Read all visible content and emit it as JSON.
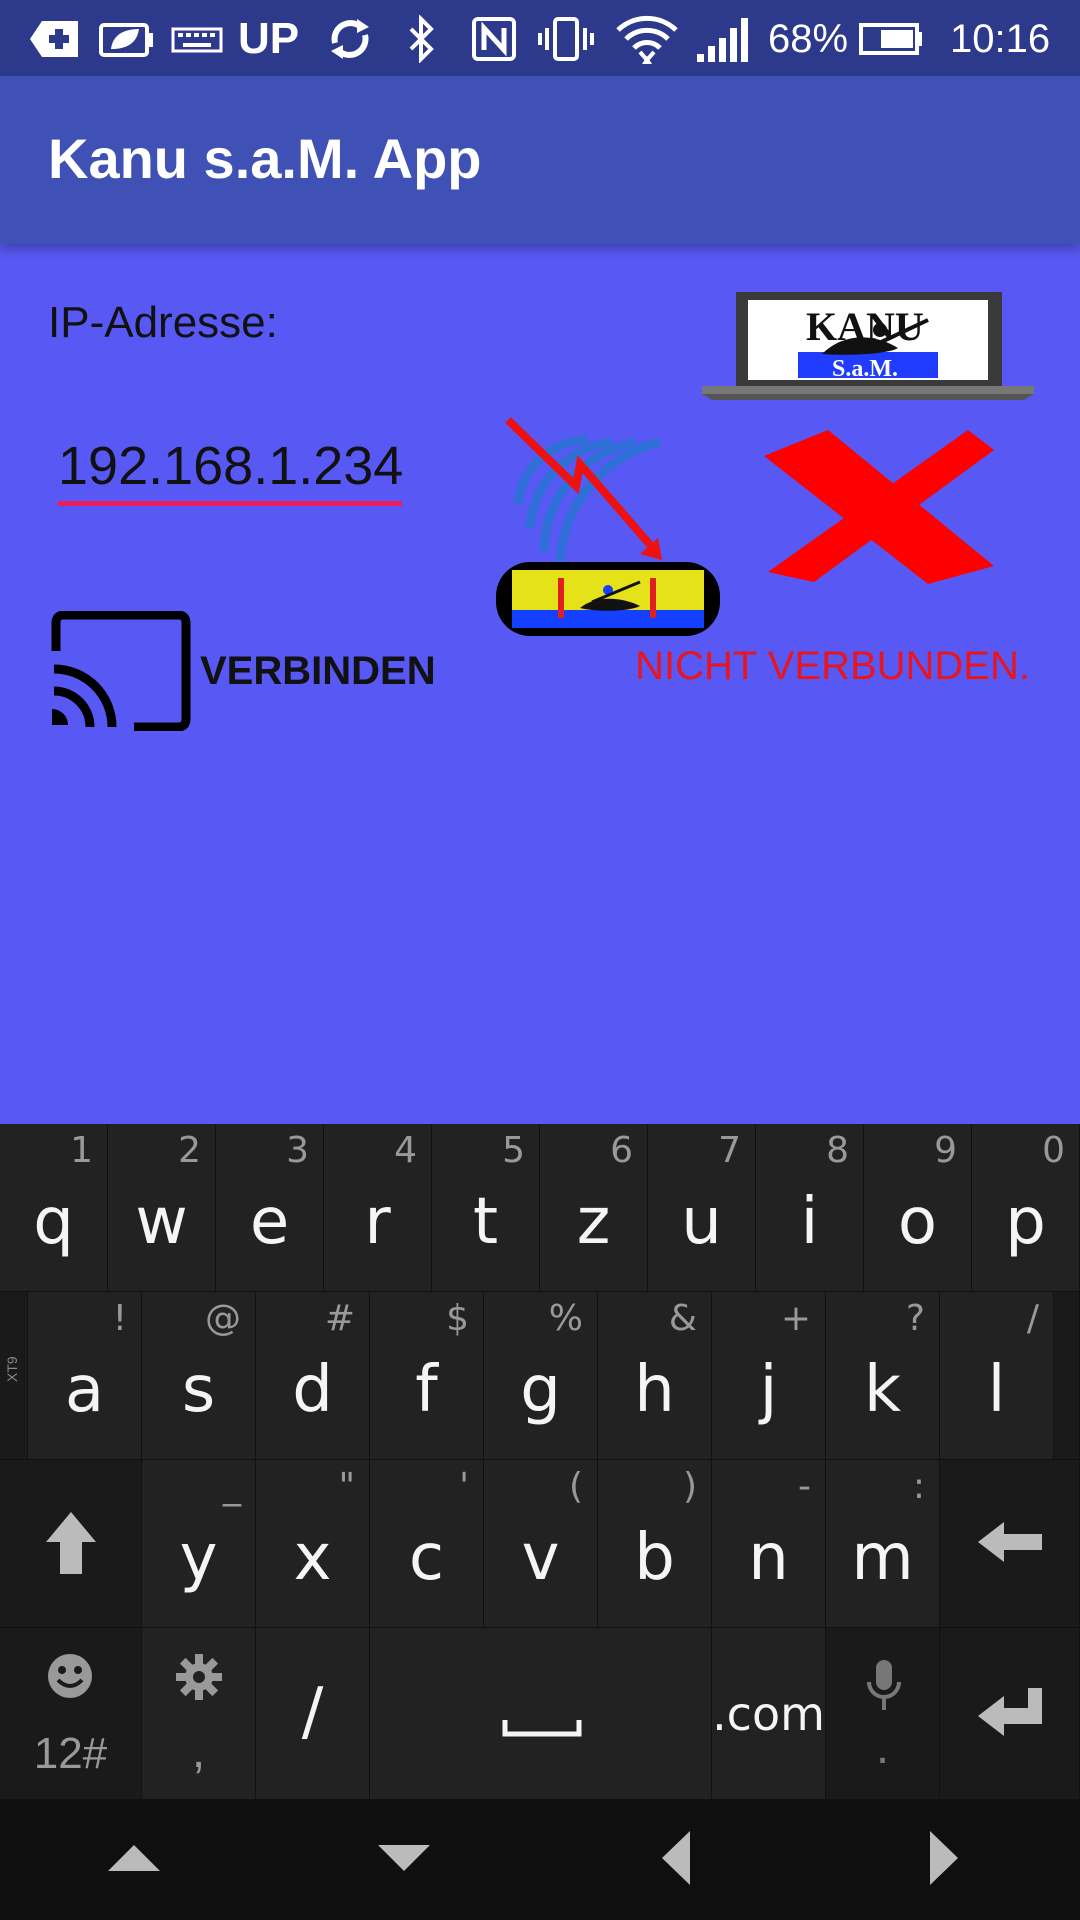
{
  "status_bar": {
    "up_label": "UP",
    "battery_percent": "68%",
    "time": "10:16"
  },
  "app_bar": {
    "title": "Kanu s.a.M. App"
  },
  "form": {
    "ip_label": "IP-Adresse:",
    "ip_value": "192.168.1.234"
  },
  "connect_button": {
    "label": "VERBINDEN"
  },
  "connection_status": {
    "text": "NICHT VERBUNDEN.",
    "color": "#e8141e"
  },
  "logo": {
    "line1": "KANU",
    "line2": "S.a.M."
  },
  "keyboard": {
    "row1": [
      {
        "main": "q",
        "hint": "1"
      },
      {
        "main": "w",
        "hint": "2"
      },
      {
        "main": "e",
        "hint": "3"
      },
      {
        "main": "r",
        "hint": "4"
      },
      {
        "main": "t",
        "hint": "5"
      },
      {
        "main": "z",
        "hint": "6"
      },
      {
        "main": "u",
        "hint": "7"
      },
      {
        "main": "i",
        "hint": "8"
      },
      {
        "main": "o",
        "hint": "9"
      },
      {
        "main": "p",
        "hint": "0"
      }
    ],
    "row2": [
      {
        "main": "a",
        "hint": "!"
      },
      {
        "main": "s",
        "hint": "@"
      },
      {
        "main": "d",
        "hint": "#"
      },
      {
        "main": "f",
        "hint": "$"
      },
      {
        "main": "g",
        "hint": "%"
      },
      {
        "main": "h",
        "hint": "&"
      },
      {
        "main": "j",
        "hint": "+"
      },
      {
        "main": "k",
        "hint": "?"
      },
      {
        "main": "l",
        "hint": "/"
      }
    ],
    "row3": [
      {
        "main": "y",
        "hint": "_"
      },
      {
        "main": "x",
        "hint": "\""
      },
      {
        "main": "c",
        "hint": "'"
      },
      {
        "main": "v",
        "hint": "("
      },
      {
        "main": "b",
        "hint": ")"
      },
      {
        "main": "n",
        "hint": "-"
      },
      {
        "main": "m",
        "hint": ":"
      }
    ],
    "side_label": "XT9",
    "symbols_label": "12#",
    "comma_label": ",",
    "slash_label": "/",
    "dotcom_label": ".com",
    "period_label": "."
  }
}
